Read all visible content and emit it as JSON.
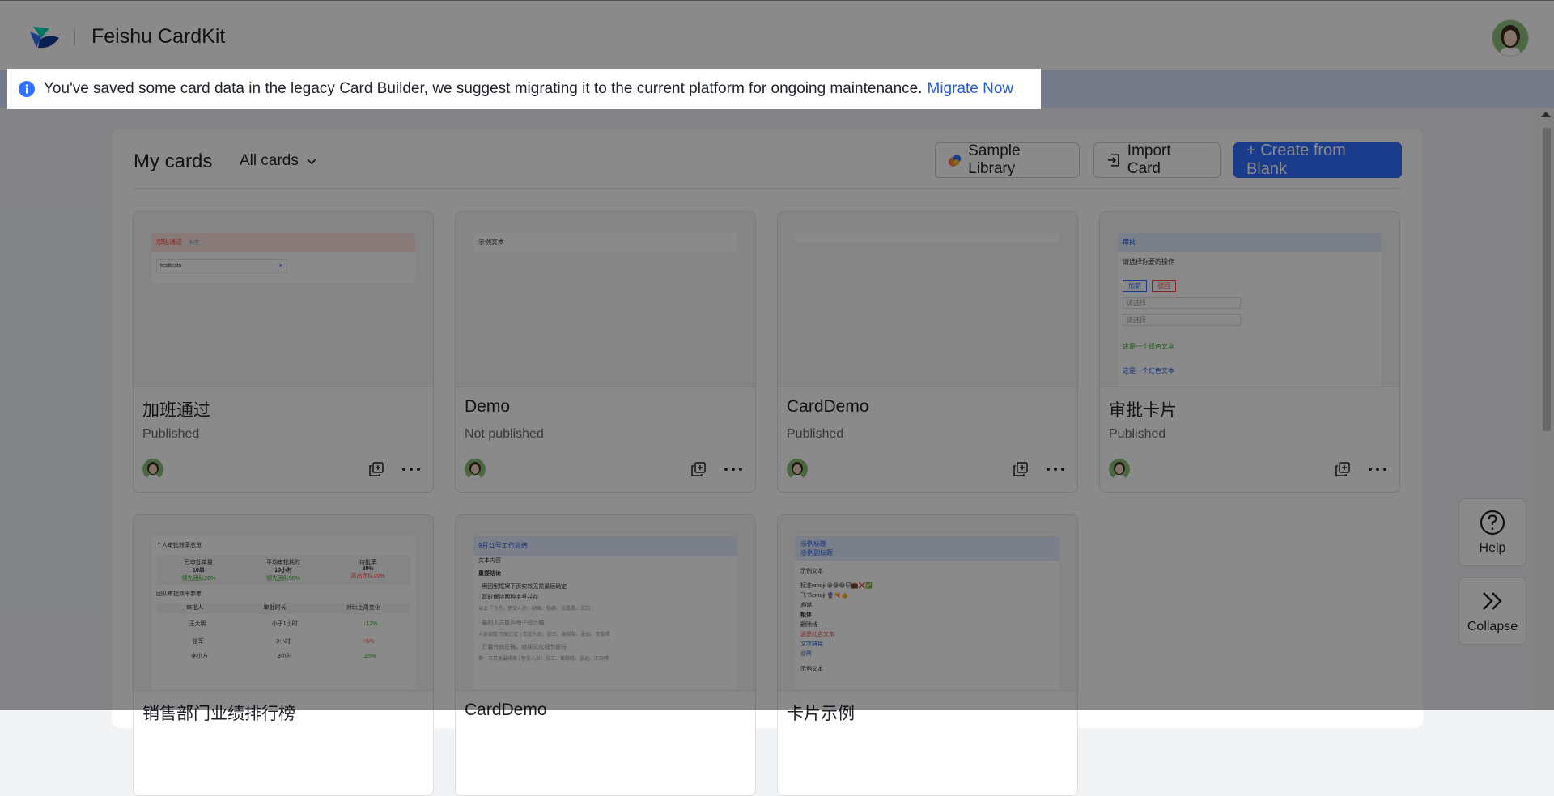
{
  "app": {
    "title": "Feishu CardKit",
    "brand_color": "#3370ff"
  },
  "notice": {
    "message": "You've saved some card data in the legacy Card Builder, we suggest migrating it to the current platform for ongoing maintenance.",
    "link_label": "Migrate Now"
  },
  "toolbar": {
    "heading": "My cards",
    "filter_label": "All cards",
    "sample_label": "Sample Library",
    "import_label": "Import Card",
    "create_label": "+ Create from Blank"
  },
  "cards": [
    {
      "name": "加班通过",
      "status": "Published",
      "preview": {
        "title": "加班通过",
        "badge": "标签",
        "input": "testtests"
      }
    },
    {
      "name": "Demo",
      "status": "Not published",
      "preview": {
        "text": "示例文本"
      }
    },
    {
      "name": "CardDemo",
      "status": "Published",
      "preview": {}
    },
    {
      "name": "审批卡片",
      "status": "Published",
      "preview": {
        "title": "审批",
        "prompt": "请选择你要的操作",
        "btn_agree": "加薪",
        "btn_reject": "驳回",
        "select1": "请选择",
        "select2": "请选择",
        "green_text": "这是一个绿色文本",
        "blue_text": "这是一个红色文本"
      }
    },
    {
      "name": "销售部门业绩排行榜",
      "status": "",
      "preview": {
        "title": "个人审批效率总览",
        "stats": [
          {
            "label": "已审批单量",
            "value": "10单",
            "cmp": "领先团队20%"
          },
          {
            "label": "平均审批耗时",
            "value": "10小时",
            "cmp": "领先团队50%"
          },
          {
            "label": "待批率",
            "value": "20%",
            "cmp": "高出团队20%"
          }
        ],
        "section": "团队审批效率参考",
        "cols": [
          "审批人",
          "审批时长",
          "对比上周变化"
        ],
        "rows": [
          [
            "王大明",
            "小于1小时",
            "↓12%"
          ],
          [
            "张军",
            "2小时",
            "↑5%"
          ],
          [
            "李小方",
            "3小时",
            "↓25%"
          ]
        ]
      }
    },
    {
      "name": "CardDemo",
      "status": "",
      "preview": {
        "title": "9月11号工作总结",
        "sub": "文本内容",
        "heading": "重要结论",
        "lines": [
          "· 用团型框架下页实效无需最后确定",
          "· 暂时保持两种字号并存",
          "以上「飞书」参交人员：顾峰、杨娜、张晨晨、古阳",
          "· 最的人员能否图子设计稿",
          "人员调整 方案已定 | 参交人员：张三、黄晓晓、张运、王晓晴",
          "· 万量方向正确，继续优化细节部分",
          "第一天开发最结果 | 参交人员：张三、黄晓晓、张运、王晓晴"
        ]
      }
    },
    {
      "name": "卡片示例",
      "status": "",
      "preview": {
        "title": "示例标题",
        "subtitle": "示例副标题",
        "lines": [
          "示例文本",
          "标准emoji 😀😁😂🐱💼❌✅",
          "飞书emoji 🔮🔫👍",
          "斜体",
          "粗体",
          "删除线",
          "这是红色文本",
          "文字链接",
          "@所",
          "示例文本"
        ]
      }
    }
  ],
  "side": {
    "help_label": "Help",
    "collapse_label": "Collapse"
  }
}
